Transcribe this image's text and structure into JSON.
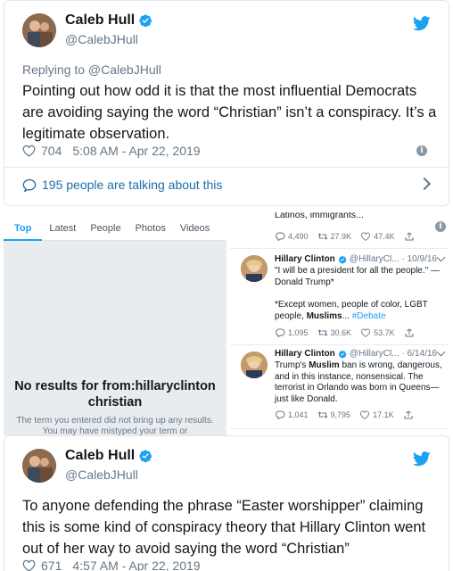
{
  "tweet1": {
    "name": "Caleb Hull",
    "handle": "@CalebJHull",
    "replying": "Replying to @CalebJHull",
    "text": "Pointing out how odd it is that the most influential Democrats are avoiding saying the word “Christian” isn’t a conspiracy. It’s a legitimate observation.",
    "likes": "704",
    "timestamp": "5:08 AM - Apr 22, 2019",
    "talking": "195 people are talking about this"
  },
  "search": {
    "tabs": [
      "Top",
      "Latest",
      "People",
      "Photos",
      "Videos"
    ],
    "no_results_title": "No results for from:hillaryclinton christian",
    "no_results_sub": "The term you entered did not bring up any results. You may have mistyped your term or",
    "tweets": [
      {
        "text_top": "Latinos, immigrants...",
        "replies": "4,490",
        "retweets": "27.9K",
        "likes": "47.4K"
      },
      {
        "name": "Hillary Clinton",
        "handle": "@HillaryCl...",
        "date": "· 10/9/16",
        "quote": "\"I will be a president for all the people.\" —Donald Trump*",
        "body_pre": "*Except women, people of color, LGBT people, ",
        "body_bold": "Muslims",
        "body_post": "... ",
        "hashtag": "#Debate",
        "replies": "1,095",
        "retweets": "30.6K",
        "likes": "53.7K"
      },
      {
        "name": "Hillary Clinton",
        "handle": "@HillaryCl...",
        "date": "· 6/14/16",
        "body_pre": "Trump's ",
        "body_bold": "Muslim",
        "body_post": " ban is wrong, dangerous, and in this instance, nonsensical. The terrorist in Orlando was born in Queens—just like Donald.",
        "replies": "1,041",
        "retweets": "9,795",
        "likes": "17.1K"
      }
    ]
  },
  "tweet2": {
    "name": "Caleb Hull",
    "handle": "@CalebJHull",
    "text": "To anyone defending the phrase “Easter worshipper” claiming this is some kind of conspiracy theory that Hillary Clinton went out of her way to avoid saying the word “Christian”",
    "likes": "671",
    "timestamp": "4:57 AM - Apr 22, 2019"
  },
  "colors": {
    "twitter_blue": "#1da1f2",
    "link_blue": "#1b6ea8",
    "muted": "#657786"
  },
  "icons": [
    "verified-badge-icon",
    "twitter-bird-icon",
    "heart-icon",
    "info-icon",
    "speech-bubble-icon",
    "chevron-right-icon",
    "reply-icon",
    "retweet-icon",
    "share-icon"
  ]
}
